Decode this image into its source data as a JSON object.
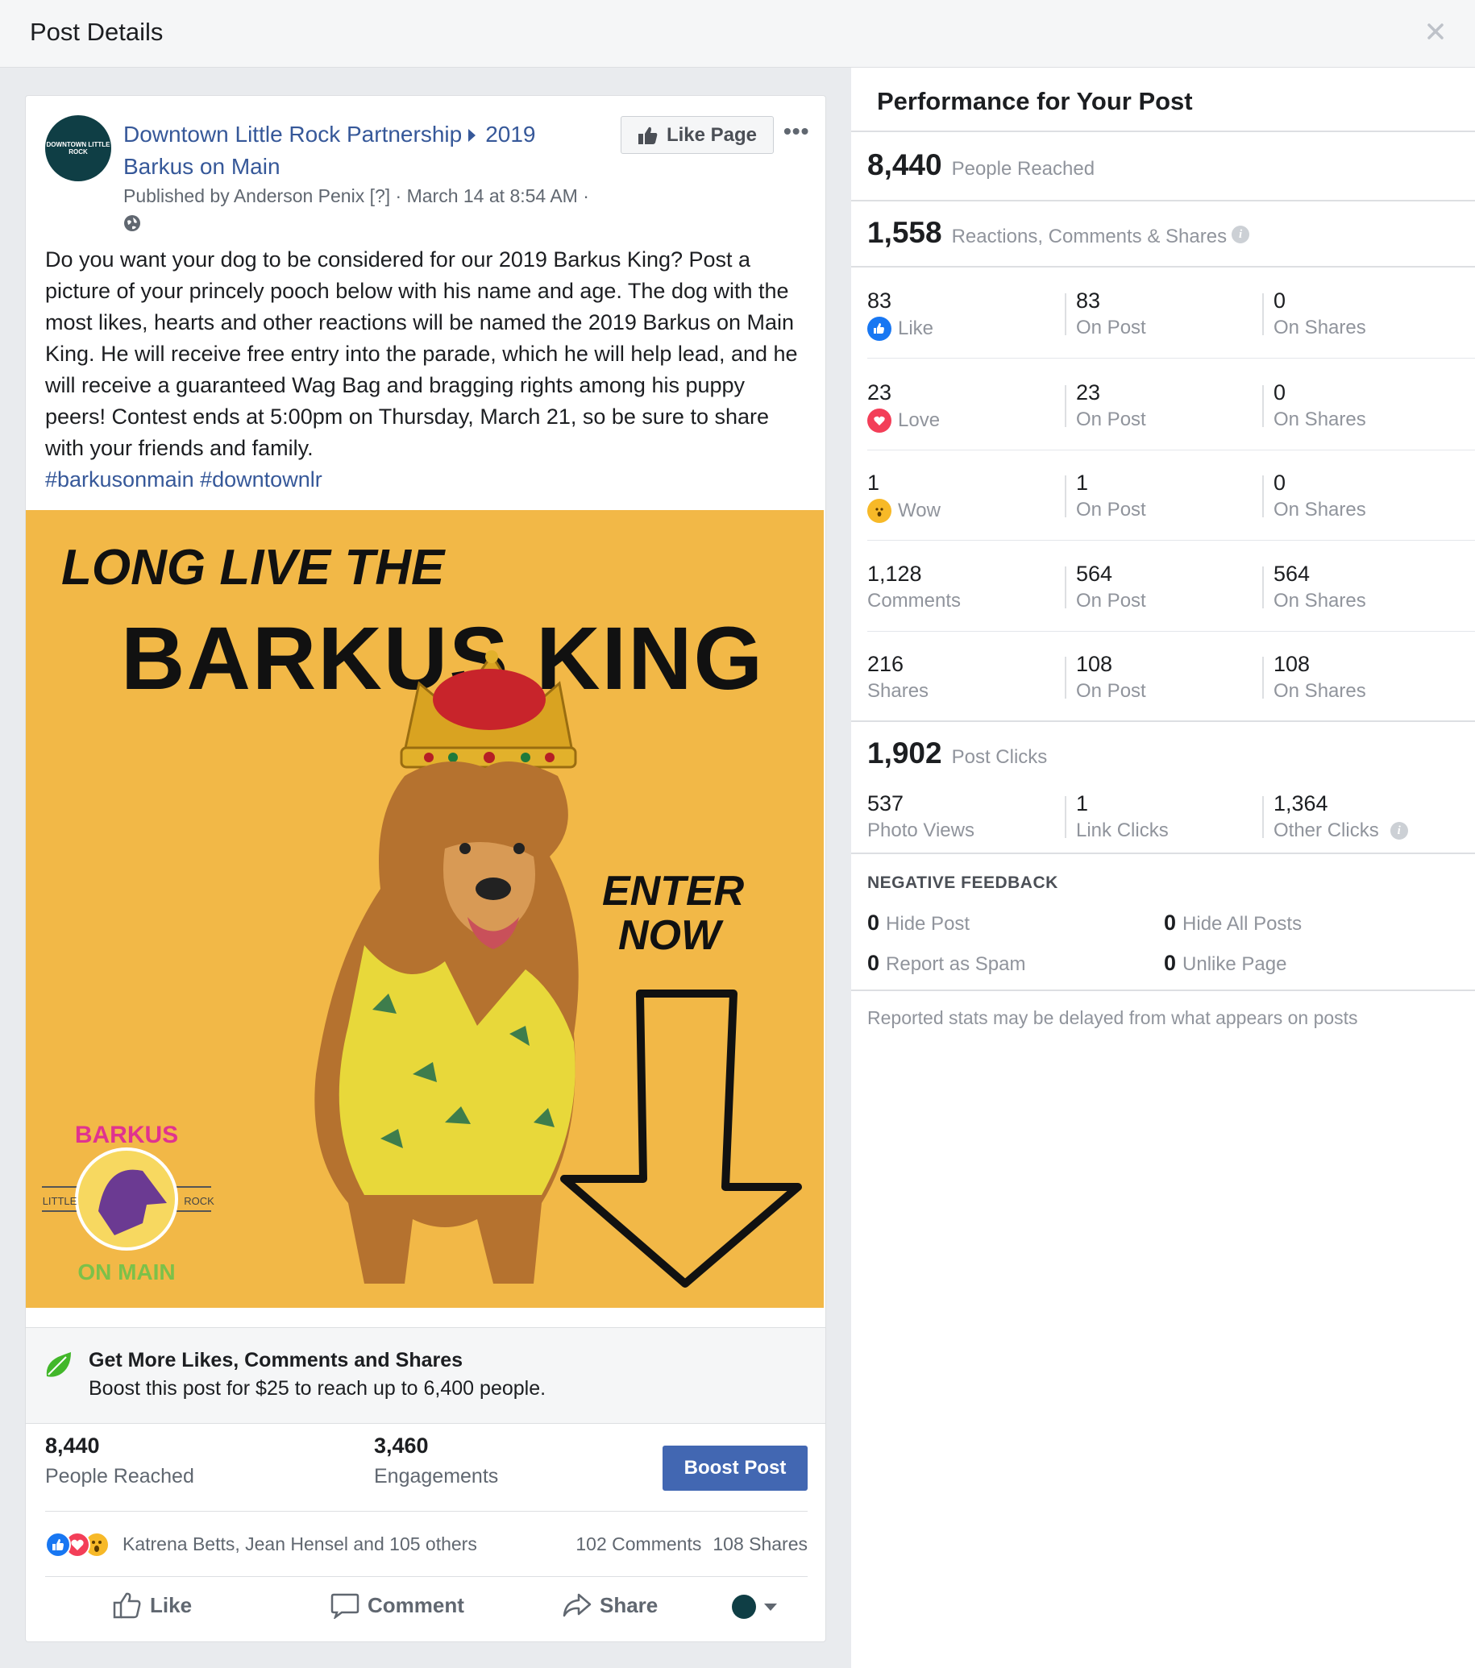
{
  "header": {
    "title": "Post Details",
    "close_icon": "close-icon"
  },
  "post": {
    "page_name": "Downtown Little Rock Partnership",
    "event_name": "2019 Barkus on Main",
    "avatar_text": "DOWNTOWN LITTLE ROCK",
    "published_by": "Published by Anderson Penix [?] · March 14 at 8:54 AM ·",
    "like_page_label": "Like Page",
    "body": "Do you want your dog to be considered for our 2019 Barkus King? Post a picture of your princely pooch below with his name and age. The dog with the most likes, hearts and other reactions will be named the 2019 Barkus on Main King. He will receive free entry into the parade, which he will help lead, and he will receive a guaranteed Wag Bag and bragging rights among his puppy peers! Contest ends at 5:00pm on Thursday, March 21, so be sure to share with your friends and family.",
    "hashtags": "#barkusonmain #downtownlr",
    "image": {
      "headline_top": "LONG LIVE THE",
      "headline_main": "BARKUS KING",
      "enter_line1": "ENTER",
      "enter_line2": "NOW",
      "logo_top": "BARKUS",
      "logo_bottom": "ON MAIN",
      "logo_left": "LITTLE",
      "logo_right": "ROCK"
    },
    "boost": {
      "title": "Get More Likes, Comments and Shares",
      "subtitle": "Boost this post for $25 to reach up to 6,400 people.",
      "button_label": "Boost Post"
    },
    "stats": {
      "reached_value": "8,440",
      "reached_label": "People Reached",
      "engagements_value": "3,460",
      "engagements_label": "Engagements"
    },
    "reactions_names": "Katrena Betts, Jean Hensel and 105 others",
    "comments_count": "102 Comments",
    "shares_count": "108 Shares",
    "actions": {
      "like": "Like",
      "comment": "Comment",
      "share": "Share"
    }
  },
  "performance": {
    "title": "Performance for Your Post",
    "people_reached": {
      "value": "8,440",
      "label": "People Reached"
    },
    "engagement_total": {
      "value": "1,558",
      "label": "Reactions, Comments & Shares"
    },
    "rows": [
      {
        "total": "83",
        "label": "Like",
        "on_post": "83",
        "on_shares": "0",
        "icon": "like-icon"
      },
      {
        "total": "23",
        "label": "Love",
        "on_post": "23",
        "on_shares": "0",
        "icon": "love-icon"
      },
      {
        "total": "1",
        "label": "Wow",
        "on_post": "1",
        "on_shares": "0",
        "icon": "wow-icon"
      },
      {
        "total": "1,128",
        "label": "Comments",
        "on_post": "564",
        "on_shares": "564"
      },
      {
        "total": "216",
        "label": "Shares",
        "on_post": "108",
        "on_shares": "108"
      }
    ],
    "on_post_label": "On Post",
    "on_shares_label": "On Shares",
    "post_clicks": {
      "value": "1,902",
      "label": "Post Clicks"
    },
    "clicks": [
      {
        "value": "537",
        "label": "Photo Views"
      },
      {
        "value": "1",
        "label": "Link Clicks"
      },
      {
        "value": "1,364",
        "label": "Other Clicks"
      }
    ],
    "negative_feedback": {
      "title": "NEGATIVE FEEDBACK",
      "items": [
        {
          "value": "0",
          "label": "Hide Post"
        },
        {
          "value": "0",
          "label": "Hide All Posts"
        },
        {
          "value": "0",
          "label": "Report as Spam"
        },
        {
          "value": "0",
          "label": "Unlike Page"
        }
      ]
    },
    "footnote": "Reported stats may be delayed from what appears on posts"
  },
  "colors": {
    "link": "#365899",
    "boost_button": "#4267b2",
    "image_bg": "#f2b847",
    "like_blue": "#1877f2",
    "love_red": "#f33e58",
    "wow_yellow": "#f7b928"
  }
}
